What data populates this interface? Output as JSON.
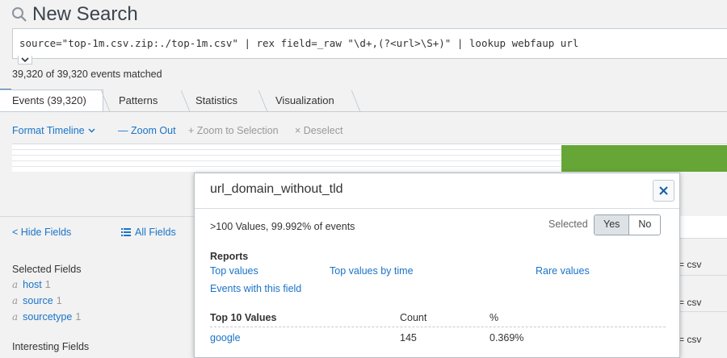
{
  "header": {
    "title": "New Search"
  },
  "search": {
    "query": "source=\"top-1m.csv.zip:./top-1m.csv\" | rex field=_raw \"\\d+,(?<url>\\S+)\" | lookup webfaup url"
  },
  "status": {
    "matched": "39,320 of 39,320 events matched"
  },
  "tabs": [
    {
      "label": "Events (39,320)"
    },
    {
      "label": "Patterns"
    },
    {
      "label": "Statistics"
    },
    {
      "label": "Visualization"
    }
  ],
  "toolbar": {
    "format_timeline": "Format Timeline",
    "zoom_out": "Zoom Out",
    "zoom_to_selection": "Zoom to Selection",
    "deselect": "Deselect"
  },
  "fields": {
    "hide_fields": "Hide Fields",
    "all_fields": "All Fields",
    "selected_heading": "Selected Fields",
    "selected": [
      {
        "type": "a",
        "name": "host",
        "count": "1"
      },
      {
        "type": "a",
        "name": "source",
        "count": "1"
      },
      {
        "type": "a",
        "name": "sourcetype",
        "count": "1"
      }
    ],
    "interesting_heading": "Interesting Fields"
  },
  "events_right": [
    "= csv",
    "= csv",
    "= csv"
  ],
  "popup": {
    "title": "url_domain_without_tld",
    "summary": ">100 Values, 99.992% of events",
    "selected_label": "Selected",
    "yes": "Yes",
    "no": "No",
    "reports_heading": "Reports",
    "reports": {
      "top_values": "Top values",
      "top_values_by_time": "Top values by time",
      "rare_values": "Rare values",
      "events_with_field": "Events with this field"
    },
    "table": {
      "col_value": "Top 10 Values",
      "col_count": "Count",
      "col_pct": "%",
      "rows": [
        {
          "value": "google",
          "count": "145",
          "pct": "0.369%"
        }
      ]
    }
  },
  "colors": {
    "link": "#1a73c8",
    "timeline_bar": "#65a637",
    "accent": "#5379af"
  }
}
